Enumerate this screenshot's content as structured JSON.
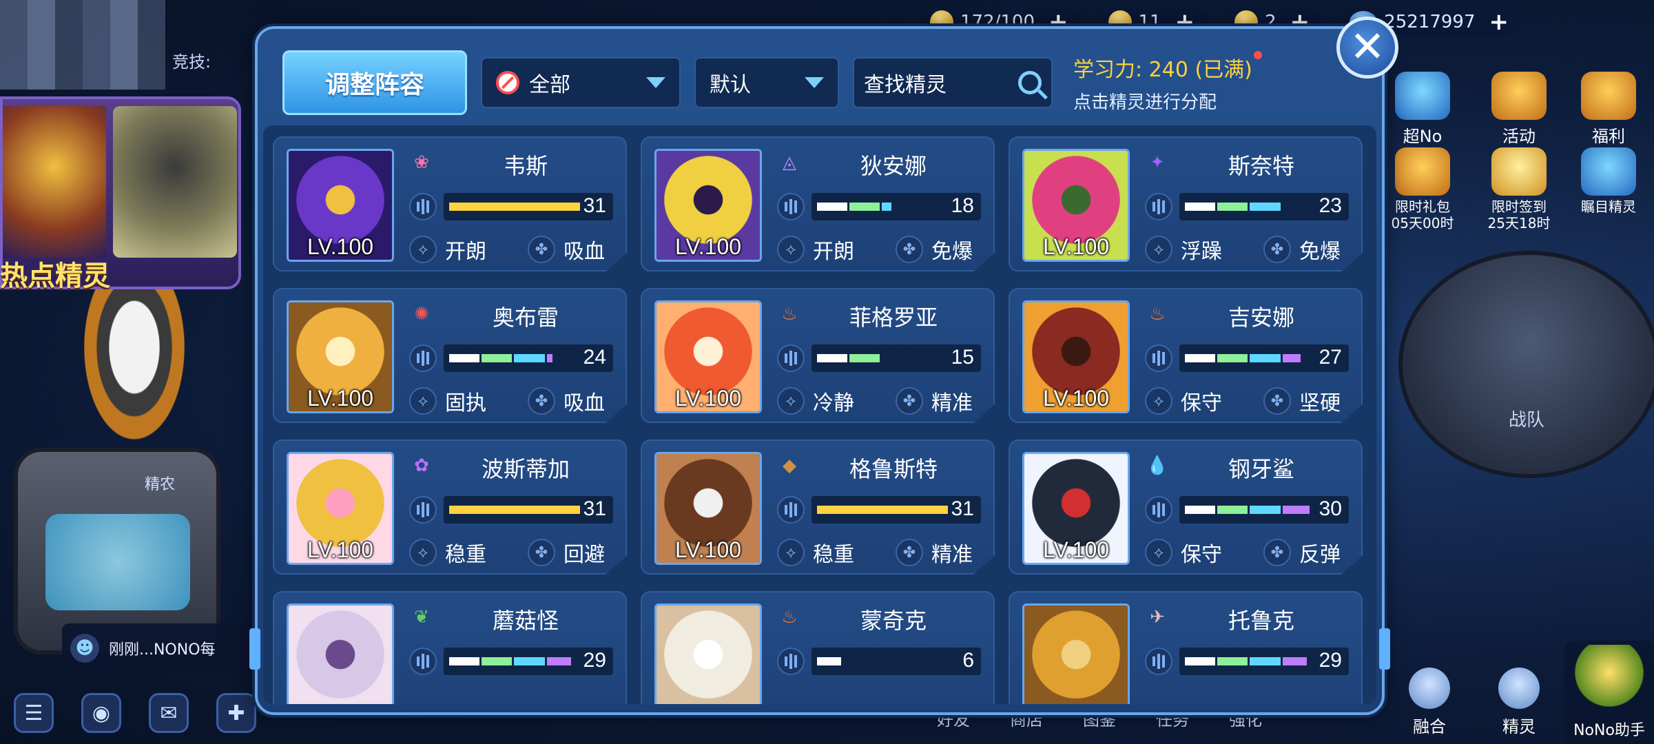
{
  "top_resources": [
    {
      "name": "energy",
      "value": "172/100"
    },
    {
      "name": "coins",
      "value": "11"
    },
    {
      "name": "gems",
      "value": "2"
    },
    {
      "name": "money",
      "value": "25217997"
    }
  ],
  "left_scene": {
    "arena_label": "竞技:",
    "hot_label": "热点精灵",
    "farm_label": "精农",
    "chat_text": "刚刚...NONO每"
  },
  "right_scene": {
    "buttons": [
      {
        "label": "超No"
      },
      {
        "label": "活动"
      },
      {
        "label": "福利"
      }
    ],
    "timed": [
      {
        "label": "限时礼包",
        "sub": "05天00时"
      },
      {
        "label": "限时签到",
        "sub": "25天18时"
      },
      {
        "label": "瞩目精灵",
        "sub": ""
      }
    ],
    "team_label": "战队",
    "bottom": [
      {
        "label": "融合"
      },
      {
        "label": "精灵"
      }
    ],
    "helper_label": "NoNo助手"
  },
  "bottom_labels": [
    "好友",
    "商店",
    "图鉴",
    "任务",
    "强化"
  ],
  "toolbar": {
    "adjust_label": "调整阵容",
    "filter_selected": "全部",
    "sort_selected": "默认",
    "search_placeholder": "查找精灵",
    "learn_line": "学习力: 240 (已满)",
    "learn_hint": "点击精灵进行分配"
  },
  "colors": {
    "gold_bar": "#ffd23f",
    "seg_white": "#ffffff",
    "seg_green": "#8ff09a",
    "seg_cyan": "#5fd8ff",
    "seg_purple": "#c07cff",
    "accent_yellow": "#ffd23f"
  },
  "pets": [
    {
      "name": "韦斯",
      "level": "LV.100",
      "value": "31",
      "bar": "gold",
      "segments": 4,
      "nature": "开朗",
      "ability": "吸血",
      "elem": "❀",
      "elem_color": "#ff6fa8",
      "art": [
        "#6a38c8",
        "#2b1a6a",
        "#f0c040"
      ]
    },
    {
      "name": "狄安娜",
      "level": "LV.100",
      "value": "18",
      "bar": "seg",
      "segments": 2.3,
      "nature": "开朗",
      "ability": "免爆",
      "elem": "◬",
      "elem_color": "#c880ff",
      "art": [
        "#f0d040",
        "#5a3aa0",
        "#2b1a4a"
      ]
    },
    {
      "name": "斯奈特",
      "level": "LV.100",
      "value": "23",
      "bar": "seg",
      "segments": 3,
      "nature": "浮躁",
      "ability": "免爆",
      "elem": "✦",
      "elem_color": "#a060ff",
      "art": [
        "#e04080",
        "#c8e050",
        "#3a6a30"
      ]
    },
    {
      "name": "奥布雷",
      "level": "LV.100",
      "value": "24",
      "bar": "seg",
      "segments": 3.2,
      "nature": "固执",
      "ability": "吸血",
      "elem": "✺",
      "elem_color": "#ff5050",
      "art": [
        "#f0b040",
        "#8a5a20",
        "#fff0c0"
      ]
    },
    {
      "name": "菲格罗亚",
      "level": "LV.100",
      "value": "15",
      "bar": "seg",
      "segments": 2,
      "nature": "冷静",
      "ability": "精准",
      "elem": "♨",
      "elem_color": "#ff7a2a",
      "art": [
        "#f05a30",
        "#ffb070",
        "#fff0d8"
      ]
    },
    {
      "name": "吉安娜",
      "level": "LV.100",
      "value": "27",
      "bar": "seg",
      "segments": 3.6,
      "nature": "保守",
      "ability": "坚硬",
      "elem": "♨",
      "elem_color": "#ff7a2a",
      "art": [
        "#8a2a20",
        "#f0a030",
        "#3a1a10"
      ]
    },
    {
      "name": "波斯蒂加",
      "level": "LV.100",
      "value": "31",
      "bar": "gold",
      "segments": 4,
      "nature": "稳重",
      "ability": "回避",
      "elem": "✿",
      "elem_color": "#c070ff",
      "art": [
        "#f0c040",
        "#ffd8e8",
        "#ff9fc0"
      ]
    },
    {
      "name": "格鲁斯特",
      "level": "LV.100",
      "value": "31",
      "bar": "gold",
      "segments": 4,
      "nature": "稳重",
      "ability": "精准",
      "elem": "◆",
      "elem_color": "#d09040",
      "art": [
        "#6a3a20",
        "#c08050",
        "#f0f0f0"
      ]
    },
    {
      "name": "钢牙鲨",
      "level": "LV.100",
      "value": "30",
      "bar": "seg",
      "segments": 3.9,
      "nature": "保守",
      "ability": "反弹",
      "elem": "💧",
      "elem_color": "#40a8ff",
      "art": [
        "#202a3a",
        "#f0f4ff",
        "#d03030"
      ]
    },
    {
      "name": "蘑菇怪",
      "level": "",
      "value": "29",
      "bar": "seg",
      "segments": 3.8,
      "nature": "",
      "ability": "",
      "elem": "❦",
      "elem_color": "#60d060",
      "art": [
        "#d8c8e8",
        "#f0e0f0",
        "#6a4a8a"
      ]
    },
    {
      "name": "蒙奇克",
      "level": "",
      "value": "6",
      "bar": "seg",
      "segments": 0.8,
      "nature": "",
      "ability": "",
      "elem": "♨",
      "elem_color": "#ff7a2a",
      "art": [
        "#f0ece0",
        "#d8c0a0",
        "#ffffff"
      ]
    },
    {
      "name": "托鲁克",
      "level": "",
      "value": "29",
      "bar": "seg",
      "segments": 3.8,
      "nature": "",
      "ability": "",
      "elem": "✈",
      "elem_color": "#e8c0c0",
      "art": [
        "#e0a030",
        "#8a5a20",
        "#f0d080"
      ]
    }
  ]
}
